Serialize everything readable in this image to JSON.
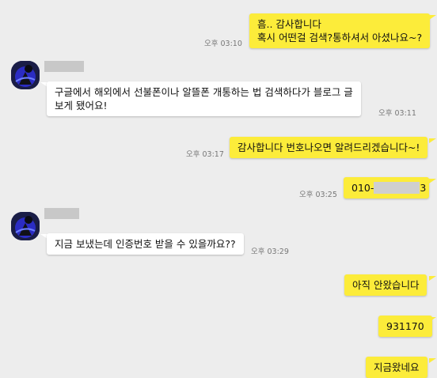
{
  "messages": [
    {
      "id": "m1",
      "direction": "out",
      "text": "흠.. 감사합니다\n혹시 어떤걸 검색?통하셔서 아셨나요~?",
      "time": "오후 03:10"
    },
    {
      "id": "m2",
      "direction": "in",
      "text": "구글에서 해외에서 선불폰이나 알뜰폰 개통하는 법 검색하다가 블로그 글\n보게 됐어요!",
      "time": "오후 03:11"
    },
    {
      "id": "m3",
      "direction": "out",
      "text": "감사합니다 번호나오면 알려드리겠습니다~!",
      "time": "오후 03:17"
    },
    {
      "id": "m4",
      "direction": "out",
      "text_prefix": "010-",
      "text_suffix": "3",
      "time": "오후 03:25"
    },
    {
      "id": "m5",
      "direction": "in",
      "text": "지금 보냈는데 인증번호 받을 수 있을까요??",
      "time": "오후 03:29"
    },
    {
      "id": "m6",
      "direction": "out",
      "text": "아직 안왔습니다"
    },
    {
      "id": "m7",
      "direction": "out",
      "text": "931170"
    },
    {
      "id": "m8",
      "direction": "out",
      "text": "지금왔네요"
    }
  ],
  "colors": {
    "background": "#ededed",
    "outgoing_bubble": "#fcec3a",
    "incoming_bubble": "#ffffff",
    "timestamp": "#777777"
  }
}
